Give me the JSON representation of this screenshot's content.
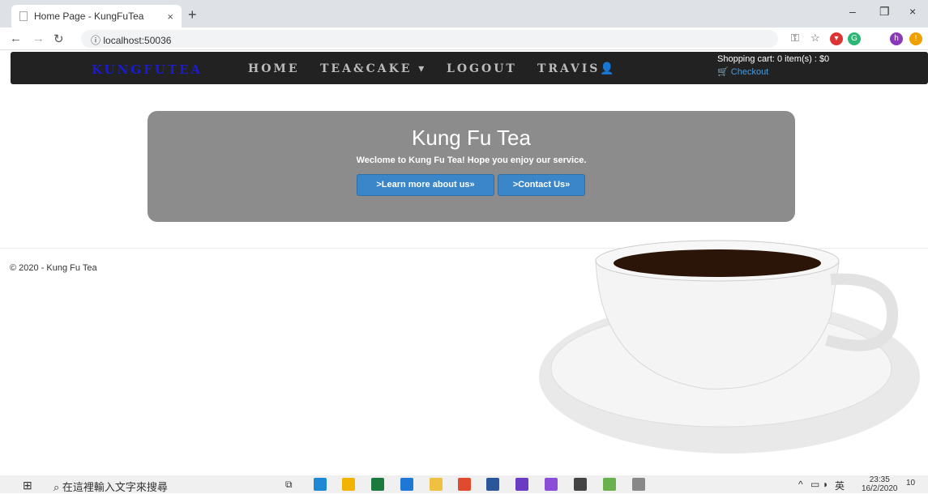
{
  "browser": {
    "tab_title": "Home Page - KungFuTea",
    "tab_close": "×",
    "new_tab": "+",
    "url": "localhost:50036",
    "win_min": "–",
    "win_max": "❐",
    "win_close": "×"
  },
  "site": {
    "brand": "KUNGFUTEA",
    "nav": [
      "HOME",
      "TEA&CAKE ▾",
      "LOGOUT",
      "TRAVIS👤"
    ],
    "cart_text": "Shopping cart: 0 item(s) : $0",
    "checkout": "Checkout"
  },
  "jumbotron": {
    "title": "Kung Fu Tea",
    "subtitle": "Weclome to Kung Fu Tea! Hope you enjoy our service.",
    "learn_button": ">Learn more about us»",
    "contact_button": ">Contact Us»"
  },
  "footer": {
    "text": "© 2020 - Kung Fu Tea"
  },
  "taskbar": {
    "search_placeholder": "在這裡輸入文字來搜尋",
    "time": "23:35",
    "date": "16/2/2020",
    "ime": "英",
    "notifications": "10"
  },
  "colors": {
    "accent": "#3a86c8",
    "nav_bg": "#222222",
    "brand": "#1a1ad6",
    "jumbo_bg": "#8c8c8c"
  }
}
